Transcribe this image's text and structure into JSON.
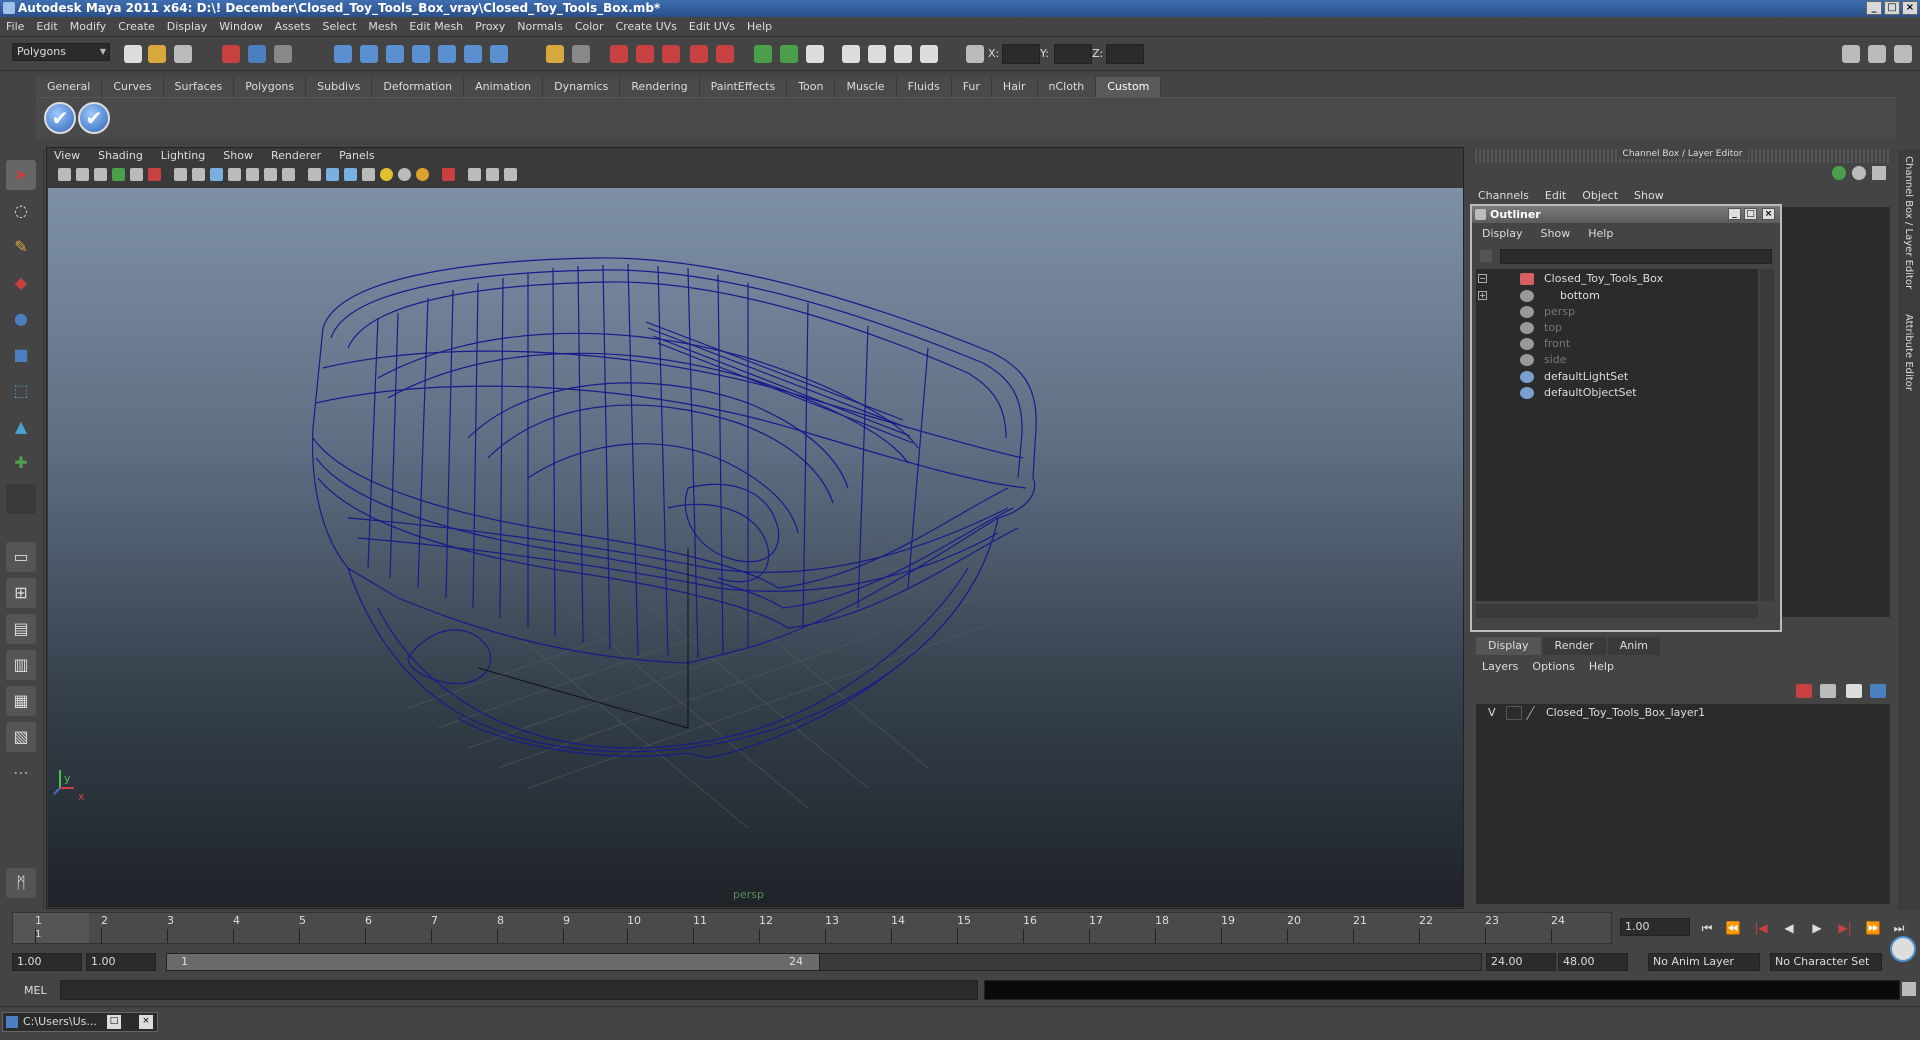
{
  "window": {
    "title": "Autodesk Maya 2011 x64: D:\\! December\\Closed_Toy_Tools_Box_vray\\Closed_Toy_Tools_Box.mb*",
    "controls": [
      "_",
      "□",
      "×"
    ]
  },
  "menubar": [
    "File",
    "Edit",
    "Modify",
    "Create",
    "Display",
    "Window",
    "Assets",
    "Select",
    "Mesh",
    "Edit Mesh",
    "Proxy",
    "Normals",
    "Color",
    "Create UVs",
    "Edit UVs",
    "Help"
  ],
  "statusline": {
    "mode": "Polygons",
    "x_label": "X:",
    "y_label": "Y:",
    "z_label": "Z:"
  },
  "shelf": {
    "tabs": [
      "General",
      "Curves",
      "Surfaces",
      "Polygons",
      "Subdivs",
      "Deformation",
      "Animation",
      "Dynamics",
      "Rendering",
      "PaintEffects",
      "Toon",
      "Muscle",
      "Fluids",
      "Fur",
      "Hair",
      "nCloth",
      "Custom"
    ],
    "active_tab": "Custom",
    "icons": [
      "checkmark-shelf-icon",
      "checkmark-shelf-icon"
    ],
    "icon_glyph": "✔"
  },
  "viewport": {
    "menu": [
      "View",
      "Shading",
      "Lighting",
      "Show",
      "Renderer",
      "Panels"
    ],
    "camera_label": "persp",
    "axis_y": "y",
    "axis_x": "x",
    "wire_color": "#1a1a8a"
  },
  "channelbox": {
    "header": "Channel Box / Layer Editor",
    "menu": [
      "Channels",
      "Edit",
      "Object",
      "Show"
    ]
  },
  "outliner": {
    "title": "Outliner",
    "menu": [
      "Display",
      "Show",
      "Help"
    ],
    "items": [
      {
        "label": "Closed_Toy_Tools_Box",
        "icon": "transform-icon"
      },
      {
        "label": "bottom",
        "icon": "mesh-icon"
      },
      {
        "label": "persp",
        "icon": "camera-icon"
      },
      {
        "label": "top",
        "icon": "camera-icon"
      },
      {
        "label": "front",
        "icon": "camera-icon"
      },
      {
        "label": "side",
        "icon": "camera-icon"
      },
      {
        "label": "defaultLightSet",
        "icon": "set-icon"
      },
      {
        "label": "defaultObjectSet",
        "icon": "set-icon"
      }
    ]
  },
  "layer_editor": {
    "tabs": [
      "Display",
      "Render",
      "Anim"
    ],
    "active_tab": "Display",
    "menu": [
      "Layers",
      "Options",
      "Help"
    ],
    "layer": {
      "visible": "V",
      "name": "Closed_Toy_Tools_Box_layer1"
    }
  },
  "side_tabs": [
    "Channel Box / Layer Editor",
    "Attribute Editor"
  ],
  "timeslider": {
    "ticks": [
      "1",
      "2",
      "3",
      "4",
      "5",
      "6",
      "7",
      "8",
      "9",
      "10",
      "11",
      "12",
      "13",
      "14",
      "15",
      "16",
      "17",
      "18",
      "19",
      "20",
      "21",
      "22",
      "23",
      "24"
    ],
    "current_frame_marker": "1",
    "current_frame": "1.00"
  },
  "playback": [
    "⏮",
    "⏪",
    "|◀",
    "◀",
    "▶",
    "▶|",
    "⏩",
    "⏭"
  ],
  "range": {
    "start": "1.00",
    "playback_start": "1.00",
    "handle_start": "1",
    "handle_end": "24",
    "playback_end": "24.00",
    "end": "48.00",
    "anim_layer": "No Anim Layer",
    "character_set": "No Character Set"
  },
  "cmdline": {
    "label": "MEL"
  },
  "taskbar": {
    "item": "C:\\Users\\Us..."
  }
}
